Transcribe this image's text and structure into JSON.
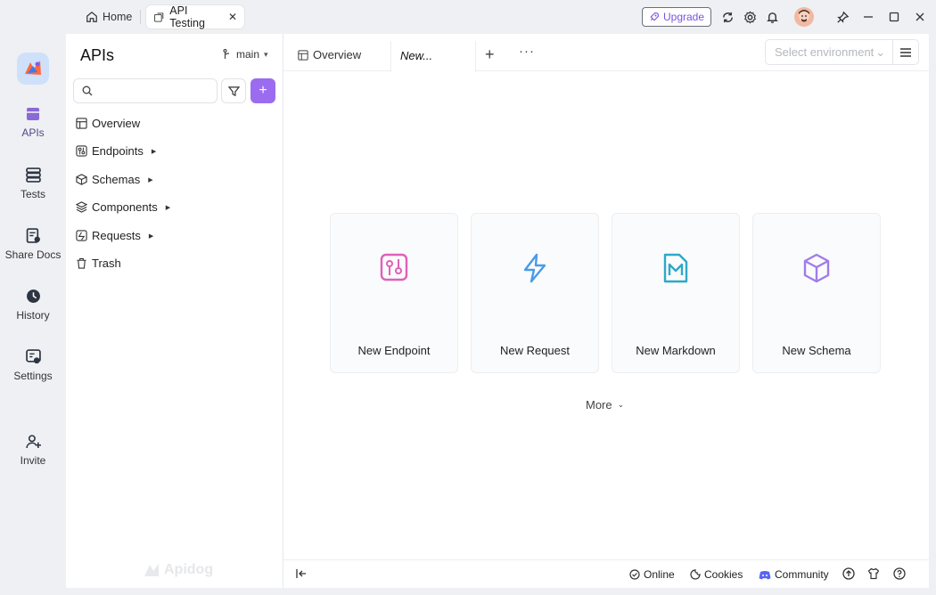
{
  "titlebar": {
    "home_label": "Home",
    "active_tab_label": "API Testing",
    "upgrade_label": "Upgrade"
  },
  "rail": {
    "items": [
      {
        "label": "APIs",
        "icon": "apis-icon"
      },
      {
        "label": "Tests",
        "icon": "tests-icon"
      },
      {
        "label": "Share Docs",
        "icon": "share-docs-icon"
      },
      {
        "label": "History",
        "icon": "history-icon"
      },
      {
        "label": "Settings",
        "icon": "settings-icon"
      },
      {
        "label": "Invite",
        "icon": "invite-icon"
      }
    ]
  },
  "sidebar": {
    "title": "APIs",
    "branch": "main",
    "search_placeholder": "",
    "tree": [
      {
        "label": "Overview",
        "expandable": false
      },
      {
        "label": "Endpoints",
        "expandable": true
      },
      {
        "label": "Schemas",
        "expandable": true
      },
      {
        "label": "Components",
        "expandable": true
      },
      {
        "label": "Requests",
        "expandable": true
      },
      {
        "label": "Trash",
        "expandable": false
      }
    ],
    "watermark": "Apidog"
  },
  "main": {
    "tabs": {
      "overview": "Overview",
      "new": "New..."
    },
    "environment_placeholder": "Select environment",
    "cards": [
      {
        "label": "New Endpoint",
        "icon": "endpoint-icon",
        "color": "#e060b8"
      },
      {
        "label": "New Request",
        "icon": "lightning-icon",
        "color": "#4a9be8"
      },
      {
        "label": "New Markdown",
        "icon": "markdown-icon",
        "color": "#2fa8c8"
      },
      {
        "label": "New Schema",
        "icon": "cube-icon",
        "color": "#a07ce8"
      }
    ],
    "more_label": "More"
  },
  "statusbar": {
    "online": "Online",
    "cookies": "Cookies",
    "community": "Community"
  },
  "colors": {
    "accent": "#9b6cf0",
    "upgrade_text": "#7a52e6"
  }
}
